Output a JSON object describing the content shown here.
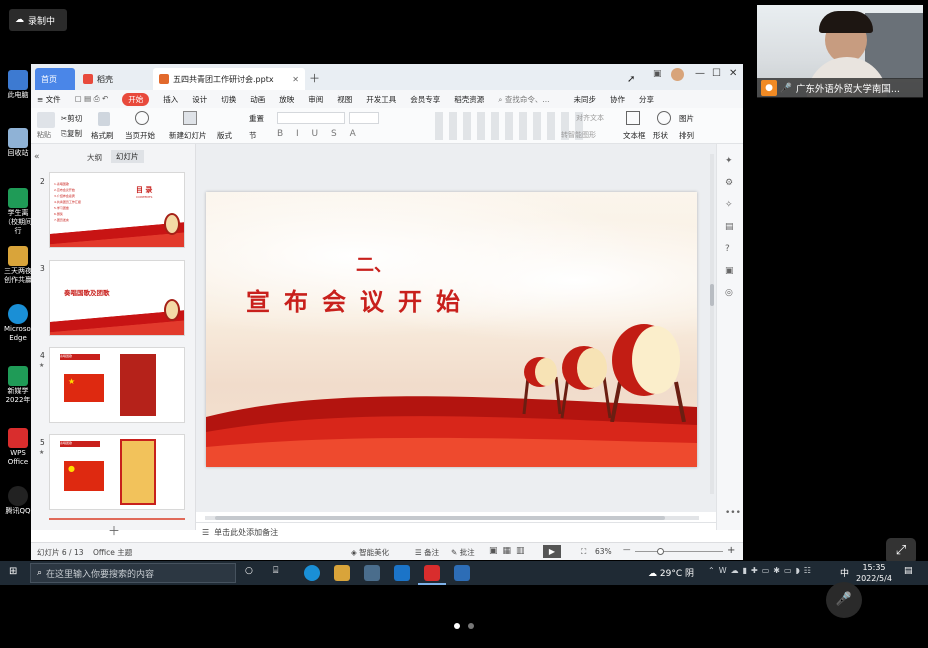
{
  "recording": {
    "label": "录制中"
  },
  "desktop": {
    "items": [
      "此电脑",
      "回收站",
      "学生离（校期间行",
      "三天两夜创作共赢",
      "Microsoft Edge",
      "新媒学2022年",
      "WPS Office",
      "腾讯QQ"
    ]
  },
  "camera": {
    "name": "广东外语外贸大学南国..."
  },
  "window": {
    "tabs": {
      "home": "首页",
      "docer": "稻壳",
      "doc": "五四共青团工作研讨会.pptx"
    },
    "menu": {
      "file": "文件",
      "items": [
        "开始",
        "插入",
        "设计",
        "切换",
        "动画",
        "放映",
        "审阅",
        "视图",
        "开发工具",
        "会员专享",
        "稻壳资源"
      ],
      "search": "查找命令、...",
      "sync": "未同步",
      "collab": "协作",
      "share": "分享"
    },
    "ribbon": {
      "paste": "粘贴",
      "cut": "剪切",
      "copy": "复制",
      "format_painter": "格式刷",
      "from_current": "当页开始",
      "new_slide": "新建幻灯片",
      "layout": "版式",
      "section": "节",
      "reset": "重置",
      "text_box": "文本框",
      "shape": "形状",
      "picture": "图片",
      "arrange": "排列",
      "align_text": "对齐文本",
      "smart_art": "转智能图形"
    },
    "panel": {
      "outline": "大纲",
      "slides": "幻灯片"
    },
    "thumbs": [
      {
        "num": "2",
        "title": "目 录",
        "subtitle": "CONTENTS",
        "items": [
          "1.奏唱国歌",
          "2.宣布会议开始",
          "3.介绍参会嘉宾",
          "4.共青团员工作汇报",
          "5.学习团章",
          "6.颁奖",
          "7.团员发言"
        ]
      },
      {
        "num": "3",
        "title": "奏唱国歌及团歌"
      },
      {
        "num": "4",
        "title": "奏唱国歌"
      },
      {
        "num": "5",
        "title": "奏唱团歌"
      }
    ],
    "slide": {
      "number": "二、",
      "title": "宣布会议开始"
    },
    "notes": "单击此处添加备注",
    "status": {
      "slide": "幻灯片 6 / 13",
      "theme": "Office 主题",
      "beautify": "智能美化",
      "notes": "备注",
      "comment": "批注",
      "zoom": "63%"
    }
  },
  "taskbar": {
    "search": "在这里输入你要搜索的内容",
    "weather": "29°C 阴",
    "ime": "中",
    "time": "15:35",
    "date": "2022/5/4"
  }
}
